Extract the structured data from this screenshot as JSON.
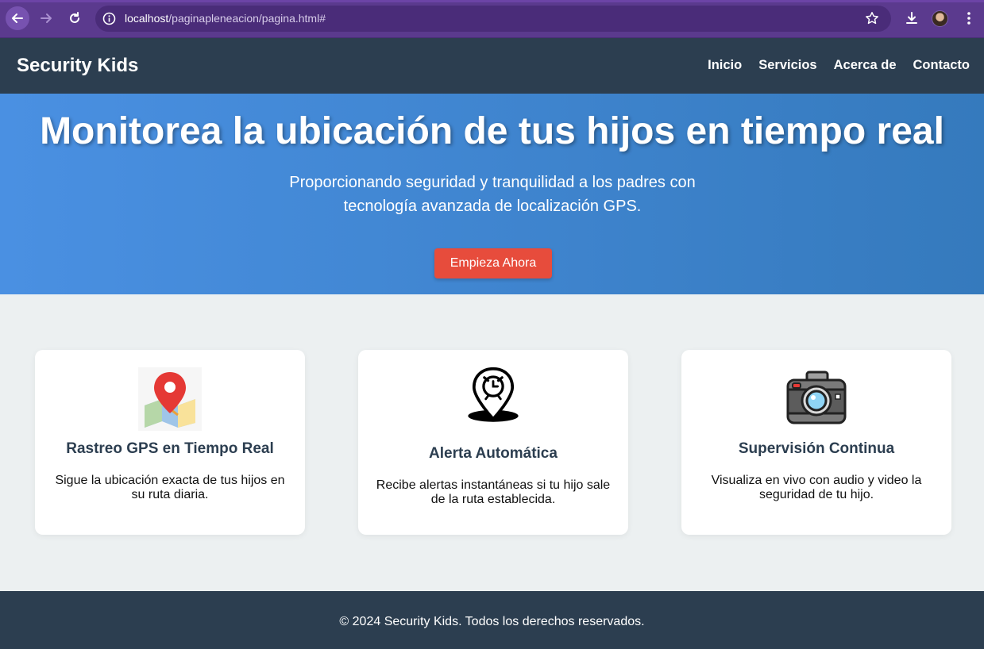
{
  "browser": {
    "url_host": "localhost",
    "url_path": "/paginapleneacion/pagina.html#"
  },
  "header": {
    "brand": "Security Kids",
    "nav": [
      "Inicio",
      "Servicios",
      "Acerca de",
      "Contacto"
    ]
  },
  "hero": {
    "title": "Monitorea la ubicación de tus hijos en tiempo real",
    "subtitle": "Proporcionando seguridad y tranquilidad a los padres con tecnología avanzada de localización GPS.",
    "cta_label": "Empieza Ahora"
  },
  "features": [
    {
      "icon": "map-pin-icon",
      "title": "Rastreo GPS en Tiempo Real",
      "text": "Sigue la ubicación exacta de tus hijos en su ruta diaria."
    },
    {
      "icon": "alarm-pin-icon",
      "title": "Alerta Automática",
      "text": "Recibe alertas instantáneas si tu hijo sale de la ruta establecida."
    },
    {
      "icon": "camera-icon",
      "title": "Supervisión Continua",
      "text": "Visualiza en vivo con audio y video la seguridad de tu hijo."
    }
  ],
  "footer": {
    "text": "© 2024 Security Kids. Todos los derechos reservados."
  },
  "colors": {
    "header_bg": "#2c3e50",
    "hero_gradient_start": "#4a90e2",
    "hero_gradient_end": "#357abd",
    "cta_bg": "#e74c3c",
    "page_bg": "#ecf0f1",
    "browser_frame": "#5b3a8e"
  }
}
